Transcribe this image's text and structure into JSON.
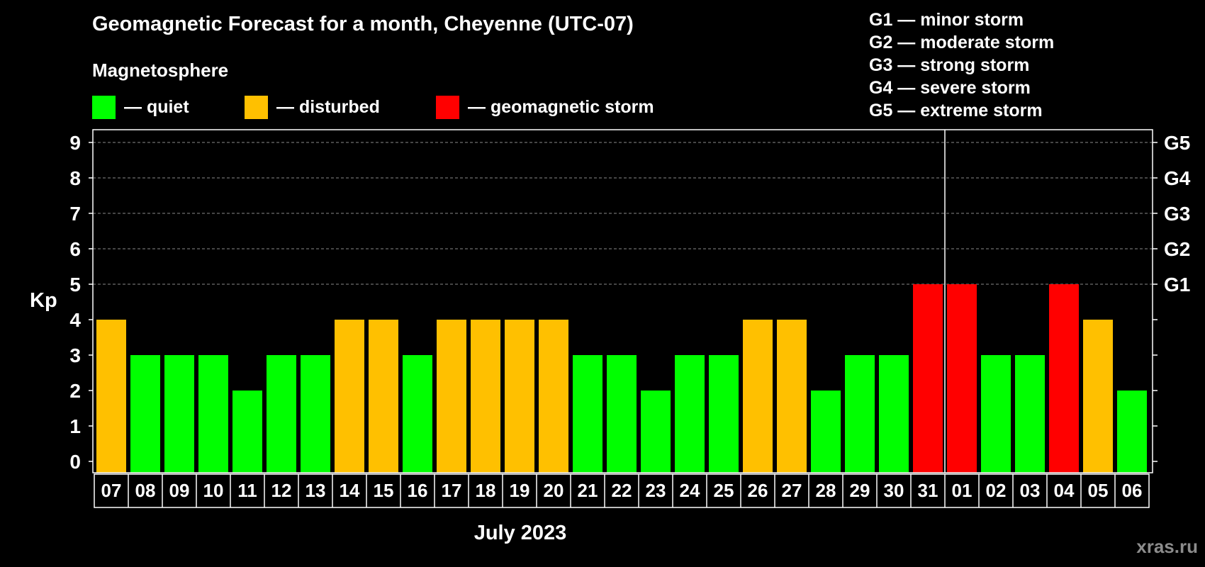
{
  "chart_data": {
    "type": "bar",
    "title": "Geomagnetic Forecast for a month, Cheyenne (UTC-07)",
    "subtitle": "Magnetosphere",
    "ylabel": "Kp",
    "xlabel": "July 2023",
    "ylim": [
      0,
      9
    ],
    "yticks": [
      "0",
      "1",
      "2",
      "3",
      "4",
      "5",
      "6",
      "7",
      "8",
      "9"
    ],
    "right_ticks": [
      {
        "value": 5,
        "label": "G1"
      },
      {
        "value": 6,
        "label": "G2"
      },
      {
        "value": 7,
        "label": "G3"
      },
      {
        "value": 8,
        "label": "G4"
      },
      {
        "value": 9,
        "label": "G5"
      }
    ],
    "gridlines": [
      5,
      6,
      7,
      8,
      9
    ],
    "month_divider_after": "31",
    "categories": [
      "07",
      "08",
      "09",
      "10",
      "11",
      "12",
      "13",
      "14",
      "15",
      "16",
      "17",
      "18",
      "19",
      "20",
      "21",
      "22",
      "23",
      "24",
      "25",
      "26",
      "27",
      "28",
      "29",
      "30",
      "31",
      "01",
      "02",
      "03",
      "04",
      "05",
      "06"
    ],
    "values": [
      4,
      3,
      3,
      3,
      2,
      3,
      3,
      4,
      4,
      3,
      4,
      4,
      4,
      4,
      3,
      3,
      2,
      3,
      3,
      4,
      4,
      2,
      3,
      3,
      5,
      5,
      3,
      3,
      5,
      4,
      2
    ],
    "level_legend": [
      {
        "label": "— quiet",
        "color": "#00ff00"
      },
      {
        "label": "— disturbed",
        "color": "#ffc000"
      },
      {
        "label": "— geomagnetic storm",
        "color": "#ff0000"
      }
    ],
    "storm_legend": [
      "G1 — minor storm",
      "G2 — moderate storm",
      "G3 — strong storm",
      "G4 — severe storm",
      "G5 — extreme storm"
    ]
  },
  "watermark": "xras.ru"
}
